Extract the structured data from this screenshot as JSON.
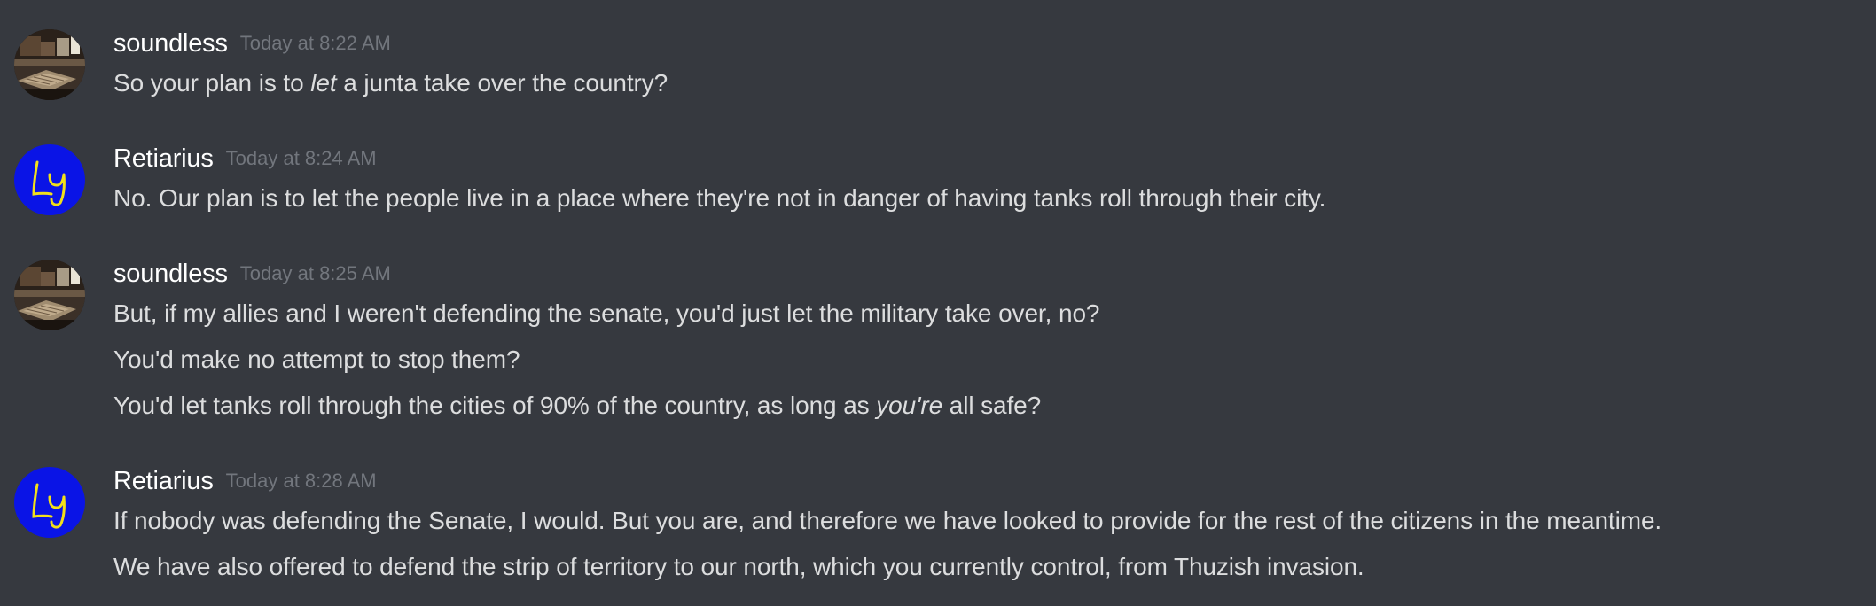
{
  "messages": [
    {
      "author": "soundless",
      "timestamp": "Today at 8:22 AM",
      "avatar_icon": "books-photo-icon",
      "lines": [
        {
          "before": "So your plan is to ",
          "em": "let",
          "after": " a junta take over the country?"
        }
      ]
    },
    {
      "author": "Retiarius",
      "timestamp": "Today at 8:24 AM",
      "avatar_icon": "ly-monogram-icon",
      "lines": [
        {
          "text": "No. Our plan is to let the people live in a place where they're not in danger of having tanks roll through their city."
        }
      ]
    },
    {
      "author": "soundless",
      "timestamp": "Today at 8:25 AM",
      "avatar_icon": "books-photo-icon",
      "lines": [
        {
          "text": "But, if my allies and I weren't defending the senate, you'd just let the military take over, no?"
        },
        {
          "text": "You'd make no attempt to stop them?"
        },
        {
          "before": "You'd let tanks roll through the cities of 90% of the country, as long as ",
          "em": "you're",
          "after": " all safe?"
        }
      ]
    },
    {
      "author": "Retiarius",
      "timestamp": "Today at 8:28 AM",
      "avatar_icon": "ly-monogram-icon",
      "lines": [
        {
          "text": "If nobody was defending the Senate, I would. But you are, and therefore we have looked to provide for the rest of the citizens in the meantime."
        },
        {
          "text": "We have also offered to defend the strip of territory to our north, which you currently control, from Thuzish invasion."
        }
      ]
    }
  ],
  "colors": {
    "background": "#36393f",
    "username": "#ffffff",
    "timestamp": "#72767d",
    "message_text": "#dcddde",
    "retiarius_avatar_bg": "#0a14e6",
    "retiarius_avatar_glyph": "#f2e01a"
  }
}
